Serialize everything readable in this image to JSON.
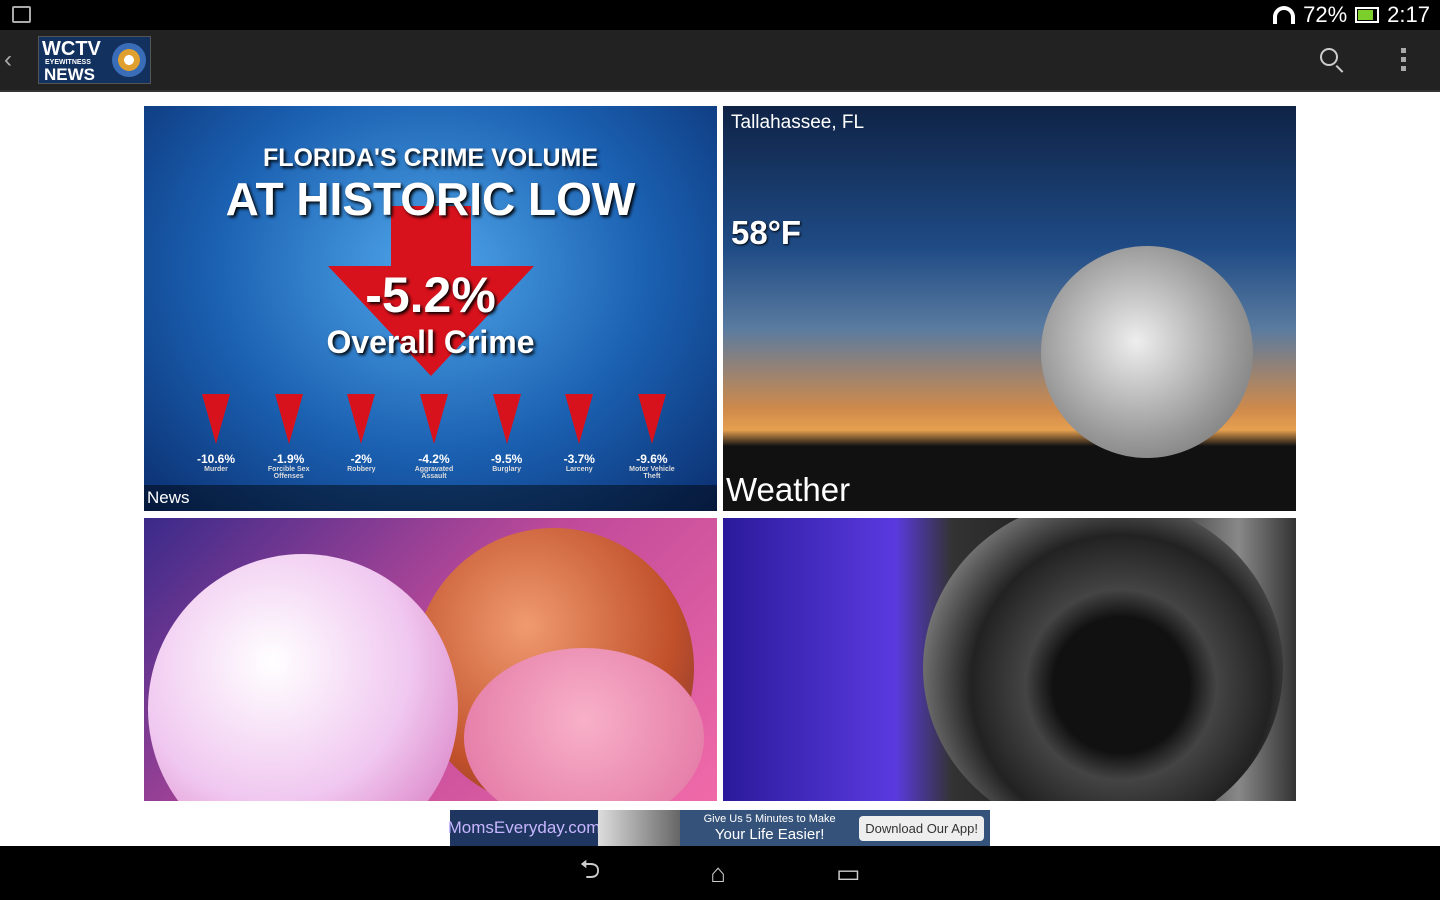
{
  "status": {
    "battery": "72%",
    "time": "2:17"
  },
  "app": {
    "logo_line1": "WCTV",
    "logo_line2": "EYEWITNESS",
    "logo_line3": "NEWS"
  },
  "news": {
    "caption": "News",
    "headline_small": "FLORIDA'S CRIME VOLUME",
    "headline_big": "AT HISTORIC LOW",
    "overall_value": "-5.2%",
    "overall_label": "Overall Crime",
    "stats": [
      {
        "value": "-10.6%",
        "label": "Murder"
      },
      {
        "value": "-1.9%",
        "label": "Forcible Sex Offenses"
      },
      {
        "value": "-2%",
        "label": "Robbery"
      },
      {
        "value": "-4.2%",
        "label": "Aggravated Assault"
      },
      {
        "value": "-9.5%",
        "label": "Burglary"
      },
      {
        "value": "-3.7%",
        "label": "Larceny"
      },
      {
        "value": "-9.6%",
        "label": "Motor Vehicle Theft"
      }
    ]
  },
  "weather": {
    "location": "Tallahassee, FL",
    "temperature": "58°F",
    "caption": "Weather"
  },
  "ad": {
    "brand": "MomsEveryday.com",
    "tag_line1": "Give Us 5 Minutes to Make",
    "tag_line2": "Your Life Easier!",
    "button": "Download Our App!"
  },
  "nav": {
    "back": "⮌",
    "home": "⌂",
    "recents": "▭"
  }
}
